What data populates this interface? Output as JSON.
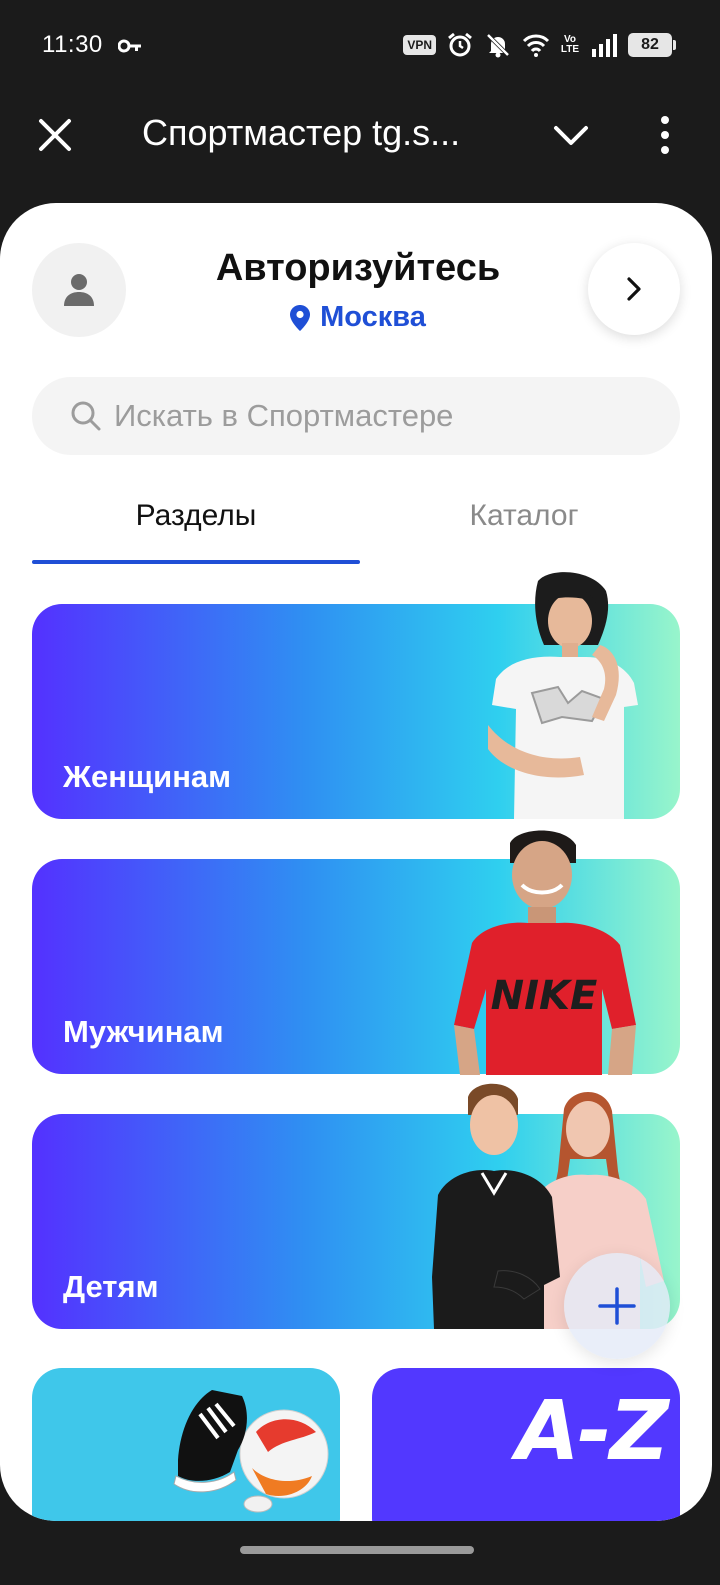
{
  "status_bar": {
    "time": "11:30",
    "vpn": "VPN",
    "volte_top": "Vo",
    "volte_bottom": "LTE",
    "battery": "82",
    "icons": [
      "key-icon",
      "alarm-icon",
      "mute-icon",
      "wifi-icon",
      "signal-icon"
    ]
  },
  "browser": {
    "title": "Спортмастер tg.s...",
    "icons": [
      "close-icon",
      "chevron-down-icon",
      "more-vert-icon"
    ]
  },
  "header": {
    "title": "Авторизуйтесь",
    "city": "Москва",
    "icons": [
      "user-icon",
      "location-pin-icon",
      "chevron-right-icon"
    ]
  },
  "search": {
    "placeholder": "Искать в Спортмастере"
  },
  "tabs": [
    {
      "label": "Разделы",
      "active": true
    },
    {
      "label": "Каталог",
      "active": false
    }
  ],
  "sections": [
    {
      "label": "Женщинам",
      "image": "woman-photo"
    },
    {
      "label": "Мужчинам",
      "image": "man-photo"
    },
    {
      "label": "Детям",
      "image": "kids-photo"
    }
  ],
  "tiles": [
    {
      "image": "sneaker-and-ball-photo"
    },
    {
      "text": "A-Z"
    }
  ],
  "fab": {
    "icon": "plus-icon"
  },
  "colors": {
    "accent": "#1f4fd6",
    "gradient": [
      "#5431ff",
      "#2f8ff2",
      "#2fcfef",
      "#98f5cb"
    ],
    "tile_sport": "#3fc7ea",
    "tile_az": "#5238ff"
  }
}
